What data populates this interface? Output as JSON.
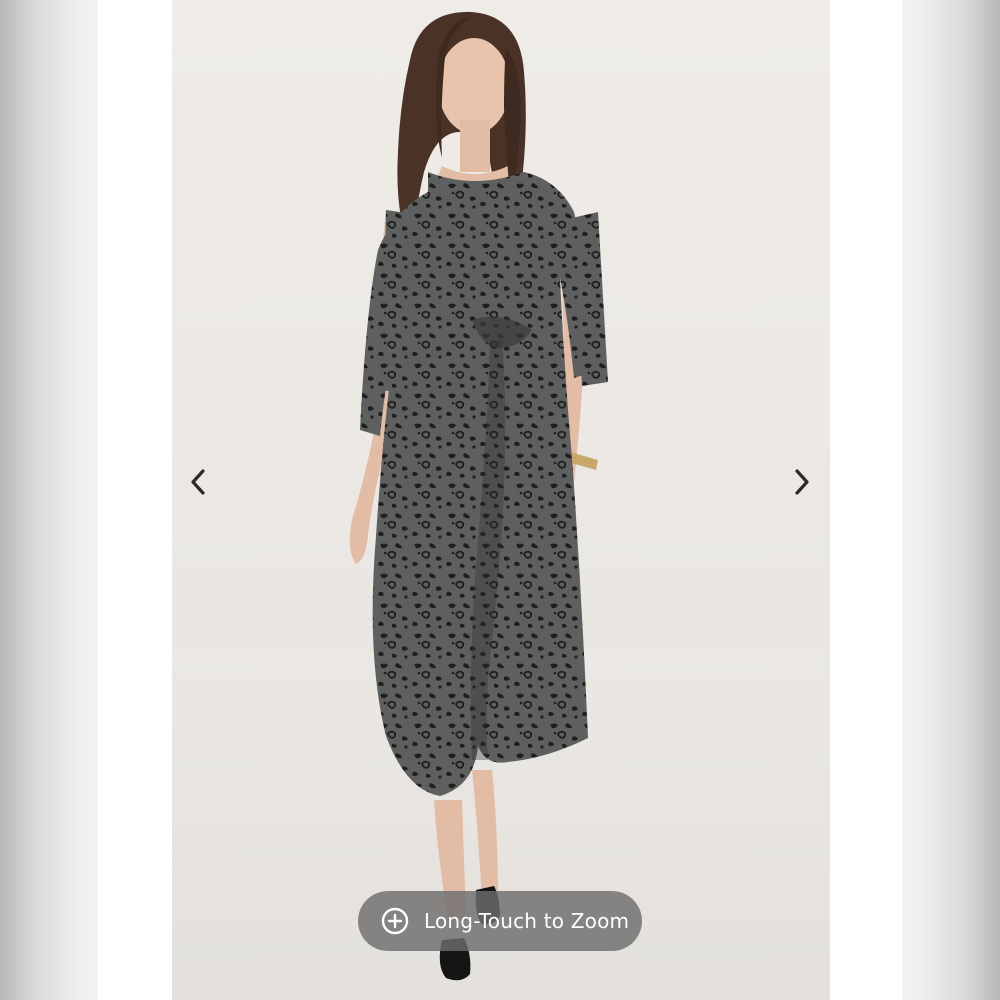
{
  "viewer": {
    "image": {
      "subject": "woman wearing grey leopard print midi dress with three-quarter sleeves and twist front",
      "background_color": "#ebe8e4",
      "dress_color": "#5e605f",
      "print_color": "#1f1f1f"
    },
    "nav": {
      "prev_icon": "chevron-left-icon",
      "next_icon": "chevron-right-icon"
    },
    "zoom_hint": {
      "icon": "plus-circle-icon",
      "label": "Long-Touch to Zoom"
    }
  },
  "colors": {
    "pill_background": "#6e6e6e",
    "pill_text": "#ffffff",
    "arrow": "#2a2a2a"
  }
}
